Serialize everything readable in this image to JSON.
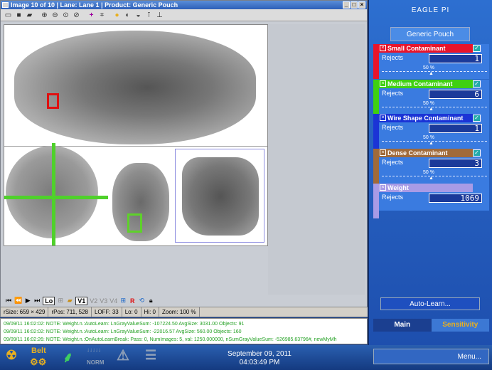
{
  "window": {
    "title": "Image 10 of 10 | Lane: Lane 1 | Product: Generic Pouch",
    "btn_min": "_",
    "btn_max": "□",
    "btn_close": "×"
  },
  "toolbar_icons": [
    "open-icon",
    "save-icon",
    "folder-icon",
    "printer-icon",
    "zoom-in-icon",
    "zoom-out-icon",
    "zoom-fit-icon",
    "zoom-actual-icon",
    "crosshair-icon",
    "fit-icon",
    "color-icon",
    "contrast-icon",
    "filter-icon",
    "measure-icon",
    "histogram-icon"
  ],
  "playbar": {
    "lo": "Lo",
    "v1": "V1",
    "v2": "V2",
    "v3": "V3",
    "v4": "V4",
    "r": "R"
  },
  "status": {
    "size": "rSize: 659 × 429",
    "pos": "rPos: 711, 528",
    "loff": "LOFF: 33",
    "lo": "Lo: 0",
    "hi": "Hi: 0",
    "zoom": "Zoom: 100 %"
  },
  "log": [
    "09/09/11 16:02:02: NOTE: Weight.n.:AutoLearn: LnGrayValueSum: -107224.50 AvgSize: 3031.00 Objects: 91",
    "09/09/11 16:02:02: NOTE: Weight.n.:AutoLearn: LnGrayValueSum: -22016.57 AvgSize: 560.00 Objects: 160",
    "09/09/11 16:02:26: NOTE: Weight.n.:OnAutoLearnBreak: Pass: 0, NumImages: 5, val: 1250.000000, nSumGrayValueSum: -526985.63796#, newMyMh"
  ],
  "bottom": {
    "belt": "Belt",
    "norm": "NORM",
    "date": "September 09, 2011",
    "time": "04:03:49 PM"
  },
  "right": {
    "app_title": "EAGLE PI",
    "product": "Generic Pouch",
    "sensitivities": [
      {
        "name": "Small Contaminant",
        "color": "#e8142b",
        "rejects_label": "Rejects",
        "rejects": "1",
        "percent": "50 %",
        "checked": true,
        "check_glyph": "✓"
      },
      {
        "name": "Medium Contaminant",
        "color": "#3fd012",
        "rejects_label": "Rejects",
        "rejects": "6",
        "percent": "50 %",
        "checked": true,
        "check_glyph": "✓"
      },
      {
        "name": "Wire Shape Contaminant",
        "color": "#1b34d6",
        "rejects_label": "Rejects",
        "rejects": "1",
        "percent": "50 %",
        "checked": true,
        "check_glyph": "✓"
      },
      {
        "name": "Dense Contaminant",
        "color": "#a06a3a",
        "rejects_label": "Rejects",
        "rejects": "3",
        "percent": "50 %",
        "checked": true,
        "check_glyph": "✓"
      },
      {
        "name": "Weight",
        "color": "#a89be6",
        "rejects_label": "Rejects",
        "rejects": "1069",
        "percent": "",
        "checked": false,
        "check_glyph": ""
      }
    ],
    "auto_learn": "Auto-Learn...",
    "tab_main": "Main",
    "tab_sensitivity": "Sensitivity",
    "menu": "Menu..."
  }
}
